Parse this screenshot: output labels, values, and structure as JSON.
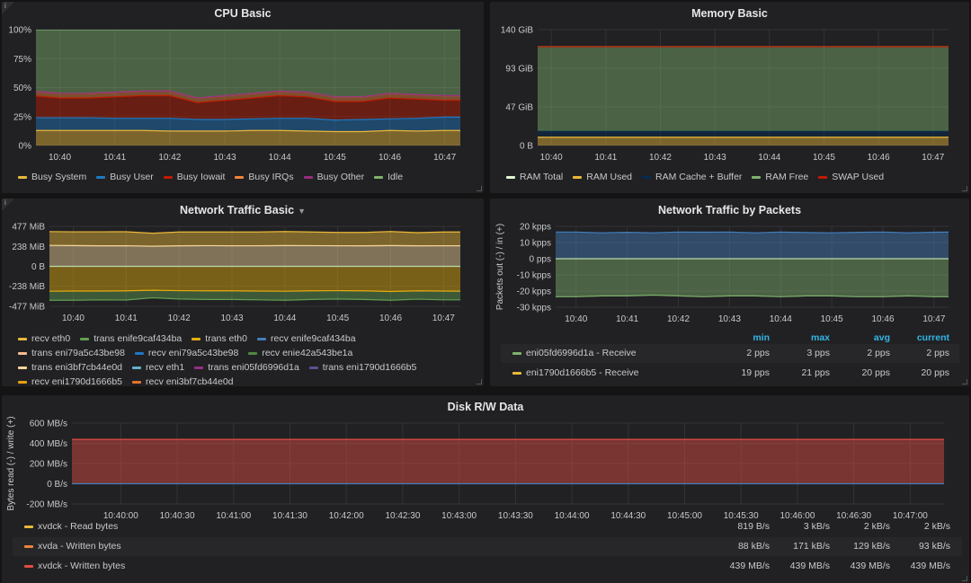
{
  "panels": {
    "cpu": {
      "title": "CPU Basic",
      "legend": [
        {
          "label": "Busy System",
          "color": "#EAB839"
        },
        {
          "label": "Busy User",
          "color": "#1F78C1"
        },
        {
          "label": "Busy Iowait",
          "color": "#BF1B00"
        },
        {
          "label": "Busy IRQs",
          "color": "#EF843C"
        },
        {
          "label": "Busy Other",
          "color": "#962D82"
        },
        {
          "label": "Idle",
          "color": "#7EB26D"
        }
      ]
    },
    "memory": {
      "title": "Memory Basic",
      "legend": [
        {
          "label": "RAM Total",
          "color": "#E0F9D7"
        },
        {
          "label": "RAM Used",
          "color": "#EAB839"
        },
        {
          "label": "RAM Cache + Buffer",
          "color": "#052B51"
        },
        {
          "label": "RAM Free",
          "color": "#7EB26D"
        },
        {
          "label": "SWAP Used",
          "color": "#BF1B00"
        }
      ]
    },
    "network": {
      "title": "Network Traffic Basic",
      "menu_icon": "caret-down-icon",
      "legend": [
        {
          "label": "recv eth0",
          "color": "#EAB839"
        },
        {
          "label": "trans enife9caf434ba",
          "color": "#629E51"
        },
        {
          "label": "trans eth0",
          "color": "#E5AC0E"
        },
        {
          "label": "recv enife9caf434ba",
          "color": "#447EBC"
        },
        {
          "label": "trans eni79a5c43be98",
          "color": "#F9BA8F"
        },
        {
          "label": "recv eni79a5c43be98",
          "color": "#1F78C1"
        },
        {
          "label": "recv enie42a543be1a",
          "color": "#508642"
        },
        {
          "label": "trans eni3bf7cb44e0d",
          "color": "#F4D598"
        },
        {
          "label": "recv eth1",
          "color": "#64B0C8"
        },
        {
          "label": "trans eni05fd6996d1a",
          "color": "#962D82"
        },
        {
          "label": "trans eni1790d1666b5",
          "color": "#614D93"
        },
        {
          "label": "recv eni1790d1666b5",
          "color": "#E5A10E"
        },
        {
          "label": "recv eni3bf7cb44e0d",
          "color": "#E0752D"
        }
      ]
    },
    "packets": {
      "title": "Network Traffic by Packets",
      "columns": [
        "min",
        "max",
        "avg",
        "current"
      ],
      "rows": [
        {
          "name": "eni05fd6996d1a - Receive",
          "color": "#7EB26D",
          "values": [
            "2 pps",
            "3 pps",
            "2 pps",
            "2 pps"
          ]
        },
        {
          "name": "eni1790d1666b5 - Receive",
          "color": "#EAB839",
          "values": [
            "19 pps",
            "21 pps",
            "20 pps",
            "20 pps"
          ]
        }
      ]
    },
    "disk": {
      "title": "Disk R/W Data",
      "rows": [
        {
          "name": "xvdck - Read bytes",
          "color": "#EAB839",
          "values": [
            "819 B/s",
            "3 kB/s",
            "2 kB/s",
            "2 kB/s"
          ]
        },
        {
          "name": "xvda - Written bytes",
          "color": "#EF843C",
          "values": [
            "88 kB/s",
            "171 kB/s",
            "129 kB/s",
            "93 kB/s"
          ]
        },
        {
          "name": "xvdck - Written bytes",
          "color": "#E24D42",
          "values": [
            "439 MB/s",
            "439 MB/s",
            "439 MB/s",
            "439 MB/s"
          ]
        }
      ]
    }
  },
  "chart_data": [
    {
      "id": "cpu",
      "type": "area",
      "stacked": true,
      "grid": true,
      "xlim": [
        "10:39:34",
        "10:47:17"
      ],
      "ylim": [
        0,
        100
      ],
      "xticks": [
        "10:40",
        "10:41",
        "10:42",
        "10:43",
        "10:44",
        "10:45",
        "10:46",
        "10:47"
      ],
      "yticks": [
        {
          "v": 0,
          "label": "0%"
        },
        {
          "v": 25,
          "label": "25%"
        },
        {
          "v": 50,
          "label": "50%"
        },
        {
          "v": 75,
          "label": "75%"
        },
        {
          "v": 100,
          "label": "100%"
        }
      ],
      "x": [
        "10:39:30",
        "10:40:00",
        "10:40:30",
        "10:41:00",
        "10:41:30",
        "10:42:00",
        "10:42:30",
        "10:43:00",
        "10:43:30",
        "10:44:00",
        "10:44:30",
        "10:45:00",
        "10:45:30",
        "10:46:00",
        "10:46:30",
        "10:47:00",
        "10:47:30"
      ],
      "series": [
        {
          "name": "Busy System",
          "color": "#EAB839",
          "values": [
            13,
            13,
            13,
            13,
            13,
            12.5,
            12.5,
            12.5,
            13,
            13,
            12.5,
            12,
            12,
            13,
            12.5,
            13,
            13
          ]
        },
        {
          "name": "Busy User",
          "color": "#1F78C1",
          "values": [
            11,
            11,
            11,
            10.5,
            10.5,
            11,
            10,
            10,
            10,
            10.5,
            11,
            10,
            10.5,
            10,
            11,
            11.5,
            11.5
          ]
        },
        {
          "name": "Busy Iowait",
          "color": "#BF1B00",
          "values": [
            19,
            17,
            17,
            18.5,
            19.5,
            19.5,
            14.5,
            16.5,
            18,
            19.5,
            18.5,
            16,
            15.5,
            18,
            16.5,
            14.5,
            14.5
          ]
        },
        {
          "name": "Busy IRQs",
          "color": "#EF843C",
          "values": [
            4,
            4,
            4,
            4,
            4,
            4,
            4,
            4,
            4,
            4,
            4,
            4,
            4,
            4,
            4,
            4,
            4
          ]
        },
        {
          "name": "Busy Other",
          "color": "#962D82",
          "values": [
            0,
            0,
            0,
            0,
            0,
            0,
            0,
            0,
            0,
            0,
            0,
            0,
            0,
            0,
            0,
            0,
            0
          ]
        },
        {
          "name": "Idle",
          "color": "#7EB26D",
          "values": [
            53,
            55,
            55,
            54,
            53,
            53,
            59,
            57,
            55,
            53,
            54,
            58,
            58,
            55,
            56,
            57,
            57
          ]
        }
      ]
    },
    {
      "id": "memory",
      "type": "area",
      "stacked": true,
      "grid": true,
      "xlim": [
        "10:39:45",
        "10:47:17"
      ],
      "ylim": [
        0,
        140
      ],
      "xticks": [
        "10:40",
        "10:41",
        "10:42",
        "10:43",
        "10:44",
        "10:45",
        "10:46",
        "10:47"
      ],
      "yticks": [
        {
          "v": 0,
          "label": "0 B"
        },
        {
          "v": 46.7,
          "label": "47 GiB"
        },
        {
          "v": 93.3,
          "label": "93 GiB"
        },
        {
          "v": 140,
          "label": "140 GiB"
        }
      ],
      "x": [
        "10:39:30",
        "10:47:30"
      ],
      "series": [
        {
          "name": "RAM Used",
          "color": "#EAB839",
          "values": [
            10,
            10
          ]
        },
        {
          "name": "RAM Cache + Buffer",
          "color": "#052B51",
          "values": [
            7,
            7
          ]
        },
        {
          "name": "RAM Free",
          "color": "#7EB26D",
          "values": [
            102.5,
            102.5
          ]
        },
        {
          "name": "RAM Total",
          "color": "#BF1B00",
          "line_only": true,
          "values": [
            119.5,
            119.5
          ]
        }
      ]
    },
    {
      "id": "network",
      "type": "area",
      "stacked": true,
      "grid": true,
      "xlim": [
        "10:39:33",
        "10:47:19"
      ],
      "ylim": [
        -477,
        477
      ],
      "xticks": [
        "10:40",
        "10:41",
        "10:42",
        "10:43",
        "10:44",
        "10:45",
        "10:46",
        "10:47"
      ],
      "yticks": [
        {
          "v": -477,
          "label": "-477 MiB"
        },
        {
          "v": -238,
          "label": "-238 MiB"
        },
        {
          "v": 0,
          "label": "0 B"
        },
        {
          "v": 238,
          "label": "238 MiB"
        },
        {
          "v": 477,
          "label": "477 MiB"
        }
      ],
      "x": [
        "10:39:30",
        "10:40:00",
        "10:40:30",
        "10:41:00",
        "10:41:30",
        "10:42:00",
        "10:42:30",
        "10:43:00",
        "10:43:30",
        "10:44:00",
        "10:44:30",
        "10:45:00",
        "10:45:30",
        "10:46:00",
        "10:46:30",
        "10:47:00",
        "10:47:30"
      ],
      "series": [
        {
          "color": "#F4D598",
          "values": [
            250,
            248,
            245,
            246,
            240,
            245,
            247,
            246,
            246,
            248,
            247,
            246,
            245,
            248,
            245,
            246,
            246
          ]
        },
        {
          "color": "#EAB839",
          "values": [
            165,
            164,
            167,
            167,
            155,
            165,
            163,
            164,
            164,
            167,
            163,
            159,
            160,
            167,
            157,
            164,
            164
          ]
        },
        {
          "color": "#E5AC0E",
          "values": [
            -297,
            -295,
            -295,
            -292,
            -285,
            -290,
            -292,
            -292,
            -295,
            -297,
            -292,
            -290,
            -292,
            -300,
            -292,
            -295,
            -297
          ]
        },
        {
          "color": "#629E51",
          "values": [
            -108,
            -110,
            -105,
            -110,
            -90,
            -100,
            -103,
            -103,
            -105,
            -108,
            -103,
            -100,
            -103,
            -105,
            -100,
            -105,
            -103
          ]
        },
        {
          "color": "#B7DBAB",
          "line_only": true,
          "values": [
            0,
            0,
            0,
            0,
            0,
            0,
            0,
            0,
            0,
            0,
            0,
            0,
            0,
            0,
            0,
            0,
            0
          ]
        }
      ]
    },
    {
      "id": "packets",
      "type": "area",
      "stacked": true,
      "grid": true,
      "ylabel": "Packets out (-) / in (+)",
      "xlim": [
        "10:39:36",
        "10:47:17"
      ],
      "ylim": [
        -30,
        20
      ],
      "xticks": [
        "10:40",
        "10:41",
        "10:42",
        "10:43",
        "10:44",
        "10:45",
        "10:46",
        "10:47"
      ],
      "yticks": [
        {
          "v": -30,
          "label": "-30 kpps"
        },
        {
          "v": -20,
          "label": "-20 kpps"
        },
        {
          "v": -10,
          "label": "-10 kpps"
        },
        {
          "v": 0,
          "label": "0 pps"
        },
        {
          "v": 10,
          "label": "10 kpps"
        },
        {
          "v": 20,
          "label": "20 kpps"
        }
      ],
      "x": [
        "10:39:30",
        "10:40:00",
        "10:40:30",
        "10:41:00",
        "10:41:30",
        "10:42:00",
        "10:42:30",
        "10:43:00",
        "10:43:30",
        "10:44:00",
        "10:44:30",
        "10:45:00",
        "10:45:30",
        "10:46:00",
        "10:46:30",
        "10:47:00",
        "10:47:30"
      ],
      "series": [
        {
          "color": "#447EBC",
          "values": [
            16.5,
            16.5,
            16,
            16.3,
            16,
            16.5,
            16.4,
            16.5,
            16,
            16.5,
            16.2,
            16,
            16.3,
            16.5,
            16,
            16.4,
            16.5
          ]
        },
        {
          "color": "#7EB26D",
          "values": [
            -23.5,
            -23.5,
            -23,
            -23,
            -22.5,
            -23,
            -23.5,
            -23,
            -23,
            -23.5,
            -23,
            -23,
            -23.5,
            -23.5,
            -23,
            -23.5,
            -23.5
          ]
        },
        {
          "color": "#B7DBAB",
          "line_only": true,
          "values": [
            0,
            0,
            0,
            0,
            0,
            0,
            0,
            0,
            0,
            0,
            0,
            0,
            0,
            0,
            0,
            0,
            0
          ]
        }
      ]
    },
    {
      "id": "disk",
      "type": "area",
      "stacked": true,
      "grid": true,
      "ylabel": "Bytes read (-) / write (+)",
      "xlim": [
        "10:39:34",
        "10:47:18"
      ],
      "ylim": [
        -200,
        600
      ],
      "xticks": [
        "10:40:00",
        "10:40:30",
        "10:41:00",
        "10:41:30",
        "10:42:00",
        "10:42:30",
        "10:43:00",
        "10:43:30",
        "10:44:00",
        "10:44:30",
        "10:45:00",
        "10:45:30",
        "10:46:00",
        "10:46:30",
        "10:47:00"
      ],
      "yticks": [
        {
          "v": -200,
          "label": "-200 MB/s"
        },
        {
          "v": 0,
          "label": "0 B/s"
        },
        {
          "v": 200,
          "label": "200 MB/s"
        },
        {
          "v": 400,
          "label": "400 MB/s"
        },
        {
          "v": 600,
          "label": "600 MB/s"
        }
      ],
      "x": [
        "10:39:30",
        "10:47:30"
      ],
      "series": [
        {
          "name": "xvdck - Written bytes",
          "color": "#E24D42",
          "values": [
            439,
            439
          ]
        },
        {
          "name": "xvdck - Read bytes",
          "color": "#447EBC",
          "line_only": true,
          "values": [
            0,
            0
          ]
        }
      ]
    }
  ]
}
